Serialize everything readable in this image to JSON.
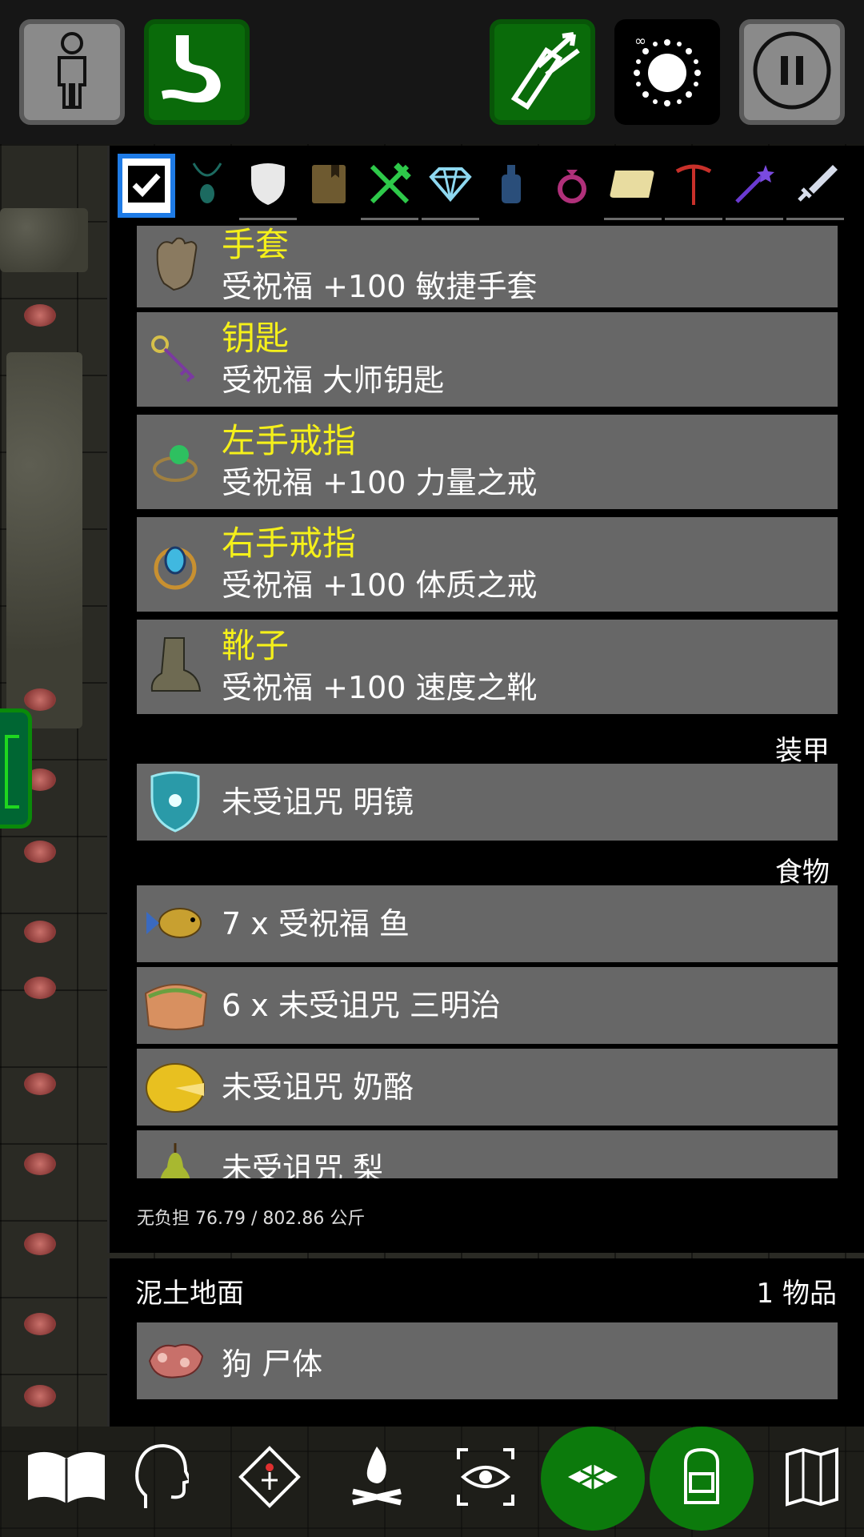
{
  "topbar": {
    "character_icon": "character-icon",
    "stomach_icon": "stomach-icon",
    "quiver_icon": "quiver-icon",
    "spell_icon": "spell-burst-icon",
    "pause_icon": "pause-icon"
  },
  "filters": [
    {
      "name": "all",
      "icon": "checkmark-icon",
      "active": true
    },
    {
      "name": "amulet",
      "icon": "amulet-icon"
    },
    {
      "name": "armor",
      "icon": "shield-icon"
    },
    {
      "name": "book",
      "icon": "book-icon"
    },
    {
      "name": "food",
      "icon": "fork-knife-icon"
    },
    {
      "name": "gem",
      "icon": "diamond-icon"
    },
    {
      "name": "potion",
      "icon": "potion-icon"
    },
    {
      "name": "ring",
      "icon": "ring-icon"
    },
    {
      "name": "scroll",
      "icon": "scroll-icon"
    },
    {
      "name": "tool",
      "icon": "pickaxe-icon"
    },
    {
      "name": "wand",
      "icon": "wand-icon"
    },
    {
      "name": "weapon",
      "icon": "sword-icon"
    }
  ],
  "inventory": {
    "equipped": [
      {
        "slot": "手套",
        "desc": "受祝福 +100 敏捷手套",
        "icon": "gloves-icon"
      },
      {
        "slot": "钥匙",
        "desc": "受祝福 大师钥匙",
        "icon": "key-icon"
      },
      {
        "slot": "左手戒指",
        "desc": "受祝福 +100 力量之戒",
        "icon": "green-ring-icon"
      },
      {
        "slot": "右手戒指",
        "desc": "受祝福 +100 体质之戒",
        "icon": "blue-ring-icon"
      },
      {
        "slot": "靴子",
        "desc": "受祝福 +100 速度之靴",
        "icon": "boots-icon"
      }
    ],
    "armor_section": "装甲",
    "armor": [
      {
        "desc": "未受诅咒 明镜",
        "icon": "mirror-shield-icon"
      }
    ],
    "food_section": "食物",
    "food": [
      {
        "desc": "7 x 受祝福 鱼",
        "icon": "fish-icon"
      },
      {
        "desc": "6 x 未受诅咒 三明治",
        "icon": "sandwich-icon"
      },
      {
        "desc": "未受诅咒 奶酪",
        "icon": "cheese-icon"
      },
      {
        "desc": "未受诅咒 梨",
        "icon": "pear-icon"
      }
    ],
    "weight": "无负担 76.79 / 802.86 公斤"
  },
  "ground": {
    "title": "泥土地面",
    "count": "1 物品",
    "items": [
      {
        "desc": "狗 尸体",
        "icon": "corpse-icon"
      }
    ]
  },
  "bottombar": [
    {
      "name": "journal",
      "icon": "open-book-icon"
    },
    {
      "name": "chat",
      "icon": "head-outline-icon"
    },
    {
      "name": "abilities",
      "icon": "diamond-sigil-icon"
    },
    {
      "name": "rest",
      "icon": "campfire-icon"
    },
    {
      "name": "look",
      "icon": "eye-focus-icon"
    },
    {
      "name": "floor",
      "icon": "tiles-icon"
    },
    {
      "name": "inventory",
      "icon": "backpack-icon"
    },
    {
      "name": "map",
      "icon": "map-icon"
    }
  ]
}
